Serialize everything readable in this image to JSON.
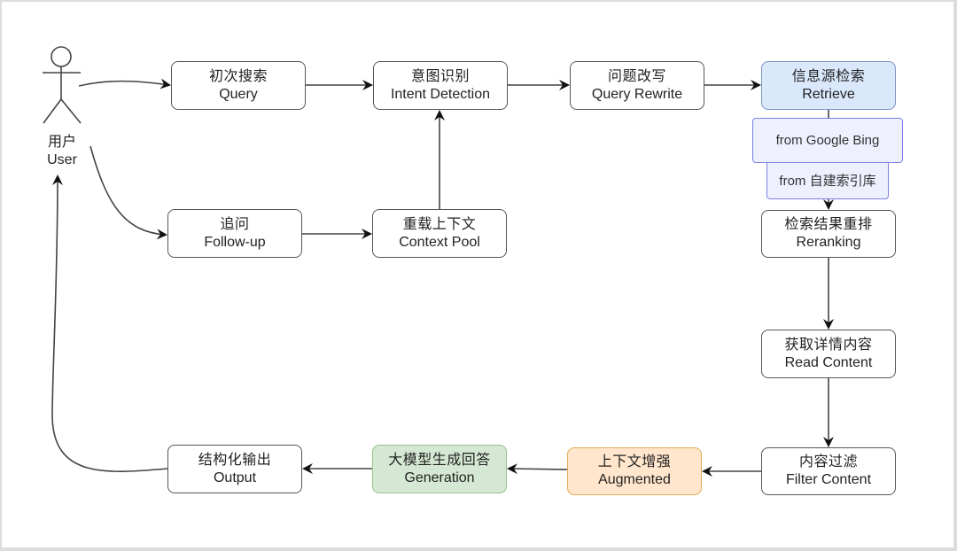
{
  "diagram": {
    "actor": {
      "zh": "用户",
      "en": "User",
      "icon": "stick-figure-icon"
    },
    "nodes": {
      "query": {
        "zh": "初次搜索",
        "en": "Query"
      },
      "intent": {
        "zh": "意图识别",
        "en": "Intent Detection"
      },
      "rewrite": {
        "zh": "问题改写",
        "en": "Query Rewrite"
      },
      "retrieve": {
        "zh": "信息源检索",
        "en": "Retrieve",
        "fill": "#dae8fc"
      },
      "source_web": {
        "label": "from Google Bing",
        "fill": "#eef0fd"
      },
      "source_index": {
        "label": "from 自建索引库",
        "fill": "#eef0fd"
      },
      "rerank": {
        "zh": "检索结果重排",
        "en": "Reranking"
      },
      "read": {
        "zh": "获取详情内容",
        "en": "Read Content"
      },
      "filter": {
        "zh": "内容过滤",
        "en": "Filter Content"
      },
      "augment": {
        "zh": "上下文增强",
        "en": "Augmented",
        "fill": "#ffe6cc"
      },
      "generate": {
        "zh": "大模型生成回答",
        "en": "Generation",
        "fill": "#d5e8d4"
      },
      "output": {
        "zh": "结构化输出",
        "en": "Output"
      },
      "followup": {
        "zh": "追问",
        "en": "Follow-up"
      },
      "context": {
        "zh": "重载上下文",
        "en": "Context Pool"
      }
    },
    "edges": [
      [
        "User",
        "Query"
      ],
      [
        "User",
        "Follow-up"
      ],
      [
        "Query",
        "Intent Detection"
      ],
      [
        "Intent Detection",
        "Query Rewrite"
      ],
      [
        "Query Rewrite",
        "Retrieve"
      ],
      [
        "Follow-up",
        "Context Pool"
      ],
      [
        "Context Pool",
        "Intent Detection"
      ],
      [
        "Retrieve",
        "Reranking"
      ],
      [
        "Reranking",
        "Read Content"
      ],
      [
        "Read Content",
        "Filter Content"
      ],
      [
        "Filter Content",
        "Augmented"
      ],
      [
        "Augmented",
        "Generation"
      ],
      [
        "Generation",
        "Output"
      ],
      [
        "Output",
        "User"
      ]
    ]
  }
}
